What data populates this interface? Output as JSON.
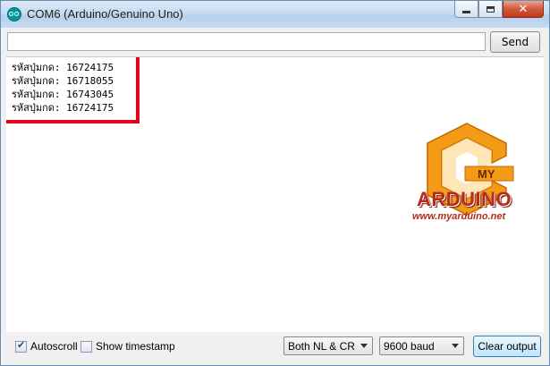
{
  "window": {
    "title": "COM6 (Arduino/Genuino Uno)",
    "icon": "arduino-icon",
    "controls": {
      "minimize": "minimize-icon",
      "maximize": "maximize-icon",
      "close": "✕"
    }
  },
  "send": {
    "value": "",
    "button_label": "Send"
  },
  "output": {
    "lines": [
      "รหัสปุ่มกด: 16724175",
      "รหัสปุ่มกด: 16718055",
      "รหัสปุ่มกด: 16743045",
      "รหัสปุ่มกด: 16724175"
    ],
    "highlight_color": "#e3001b"
  },
  "logo": {
    "badge": "MY",
    "name": "ARDUINO",
    "url": "www.myarduino.net",
    "color": "#b52b1c"
  },
  "bottom": {
    "autoscroll_label": "Autoscroll",
    "autoscroll_checked": true,
    "timestamp_label": "Show timestamp",
    "timestamp_checked": false,
    "line_ending": "Both NL & CR",
    "baud": "9600 baud",
    "clear_label": "Clear output"
  }
}
